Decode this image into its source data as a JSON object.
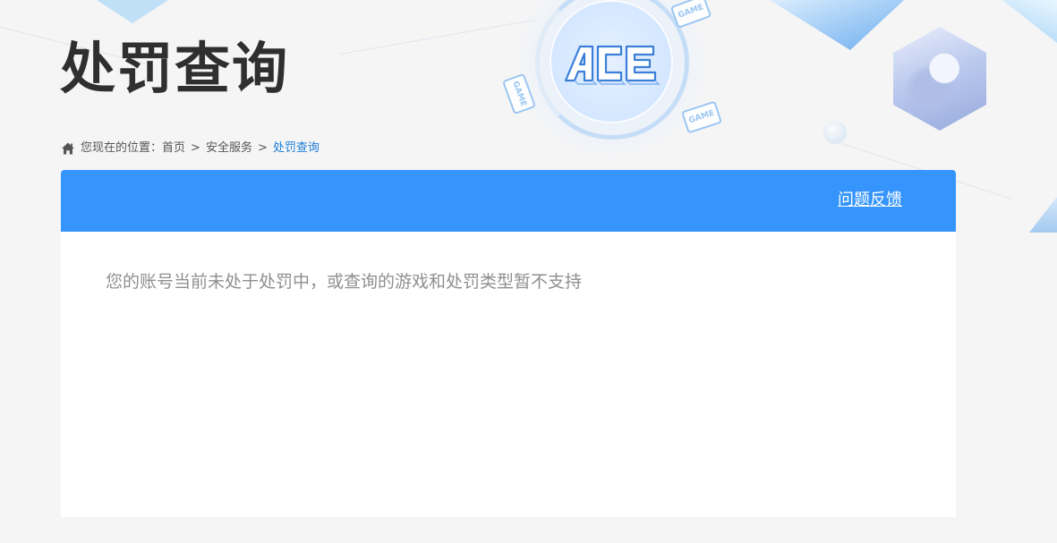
{
  "header": {
    "title": "处罚查询",
    "logo_text": "ACE",
    "game_chip_text": "GAME"
  },
  "breadcrumb": {
    "prefix": "您现在的位置：",
    "items": [
      {
        "label": "首页"
      },
      {
        "label": "安全服务"
      },
      {
        "label": "处罚查询"
      }
    ],
    "separator": ">"
  },
  "card": {
    "header_link": "问题反馈",
    "message": "您的账号当前未处于处罚中，或查询的游戏和处罚类型暂不支持"
  },
  "colors": {
    "accent": "#3595fc",
    "breadcrumb_current": "#1a7cd8",
    "title": "#2f2f2f",
    "message": "#8f8f8f"
  }
}
